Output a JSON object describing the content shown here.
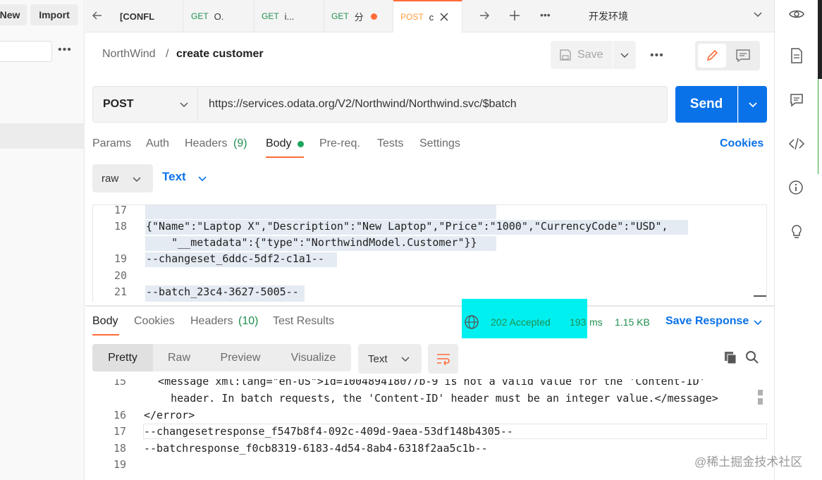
{
  "sidebar": {
    "new_label": "New",
    "import_label": "Import"
  },
  "tabs": [
    {
      "method": "",
      "label": "[CONFL",
      "method_color": "#333333"
    },
    {
      "method": "GET",
      "label": "O.",
      "method_color": "#1f8f4f"
    },
    {
      "method": "GET",
      "label": "i...",
      "method_color": "#1f8f4f"
    },
    {
      "method": "GET",
      "label": "分",
      "method_color": "#1f8f4f",
      "unsaved": true
    },
    {
      "method": "POST",
      "label": "c",
      "method_color": "#ff9a3c",
      "active": true
    }
  ],
  "environment": "开发环境",
  "header": {
    "parent": "NorthWind",
    "separator": "/",
    "title": "create customer",
    "save_label": "Save"
  },
  "request": {
    "method": "POST",
    "url": "https://services.odata.org/V2/Northwind/Northwind.svc/$batch",
    "send_label": "Send",
    "tabs": [
      "Params",
      "Auth",
      "Headers",
      "(9)",
      "Body",
      "Pre-req.",
      "Tests",
      "Settings"
    ],
    "cookies_label": "Cookies",
    "body_mode": "raw",
    "body_format": "Text"
  },
  "request_body": [
    {
      "n": "17",
      "text": ""
    },
    {
      "n": "18",
      "text": "{\"Name\":\"Laptop X\",\"Description\":\"New Laptop\",\"Price\":\"1000\",\"CurrencyCode\":\"USD\","
    },
    {
      "n": "",
      "text": "    \"__metadata\":{\"type\":\"NorthwindModel.Customer\"}}"
    },
    {
      "n": "19",
      "text": "--changeset_6ddc-5df2-c1a1--"
    },
    {
      "n": "20",
      "text": ""
    },
    {
      "n": "21",
      "text": "--batch_23c4-3627-5005--"
    }
  ],
  "response": {
    "tabs": [
      "Body",
      "Cookies",
      "Headers",
      "(10)",
      "Test Results"
    ],
    "status": "202 Accepted",
    "time": "193",
    "time_unit": "ms",
    "size": "1.15 KB",
    "save_label": "Save Response",
    "views": [
      "Pretty",
      "Raw",
      "Preview",
      "Visualize"
    ],
    "format": "Text"
  },
  "response_body": [
    {
      "n": "15",
      "text": "  <message xml:lang=\"en-US\">Id=100489418077b-9 is not a valid value for the 'Content-ID'"
    },
    {
      "n": "",
      "text": "    header. In batch requests, the 'Content-ID' header must be an integer value.</message>"
    },
    {
      "n": "16",
      "text": "</error>"
    },
    {
      "n": "17",
      "text": "--changesetresponse_f547b8f4-092c-409d-9aea-53df148b4305--"
    },
    {
      "n": "18",
      "text": "--batchresponse_f0cb8319-6183-4d54-8ab4-6318f2aa5c1b--"
    },
    {
      "n": "19",
      "text": ""
    }
  ],
  "watermark": "@稀土掘金技术社区",
  "colors": {
    "accent": "#ff6c37",
    "primary": "#0a72e8",
    "success": "#1f8f4f",
    "highlight": "#00f0f0"
  }
}
